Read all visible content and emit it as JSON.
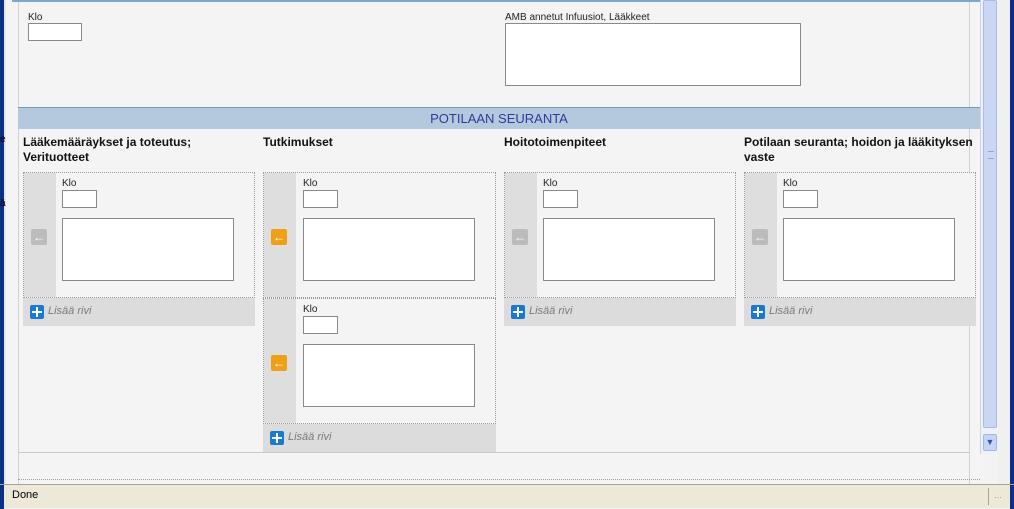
{
  "top": {
    "klo_label": "Klo",
    "amb_label": "AMB annetut Infuusiot, Lääkkeet"
  },
  "section": {
    "title": "POTILAAN SEURANTA"
  },
  "columns": [
    {
      "title": "Lääkemääräykset ja toteutus; Verituotteet",
      "rows": [
        {
          "klo_label": "Klo",
          "arrow": "grey"
        }
      ],
      "add_label": "Lisää rivi"
    },
    {
      "title": "Tutkimukset",
      "rows": [
        {
          "klo_label": "Klo",
          "arrow": "orange"
        },
        {
          "klo_label": "Klo",
          "arrow": "orange"
        }
      ],
      "add_label": "Lisää rivi"
    },
    {
      "title": "Hoitotoimenpiteet",
      "rows": [
        {
          "klo_label": "Klo",
          "arrow": "grey"
        }
      ],
      "add_label": "Lisää rivi"
    },
    {
      "title": "Potilaan seuranta; hoidon ja lääkityksen vaste",
      "rows": [
        {
          "klo_label": "Klo",
          "arrow": "grey"
        }
      ],
      "add_label": "Lisää rivi"
    }
  ],
  "icons": {
    "arrow": "arrow-left-icon",
    "add": "plus-icon",
    "scroll_down": "chevron-down-icon"
  },
  "colors": {
    "section_bar": "#b5c9de",
    "section_text": "#2b3c9a",
    "arrow_orange": "#f0a018",
    "arrow_grey": "#bcbcbc",
    "add_icon": "#1a79d0"
  },
  "status": {
    "text": "Done"
  },
  "artifacts": {
    "left_glyph_1": "e",
    "left_glyph_2": "ä"
  }
}
